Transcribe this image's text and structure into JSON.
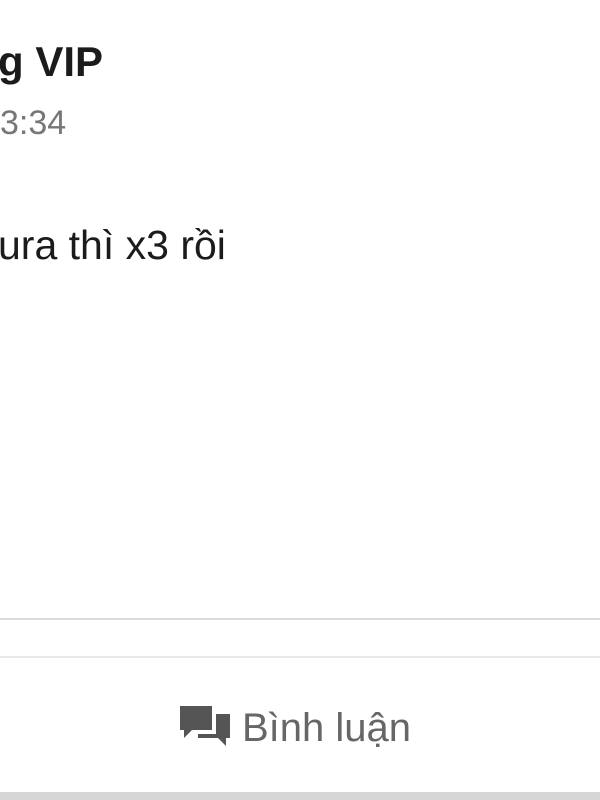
{
  "post": {
    "author_name": "g VIP",
    "time": "3:34",
    "body": "ura thì x3 rồi"
  },
  "actions": {
    "comment_label": "Bình luận",
    "comment_icon": "comments-icon"
  },
  "colors": {
    "background": "#ffffff",
    "text_primary": "#1b1b1b",
    "text_secondary": "#777777",
    "icon": "#555555"
  }
}
